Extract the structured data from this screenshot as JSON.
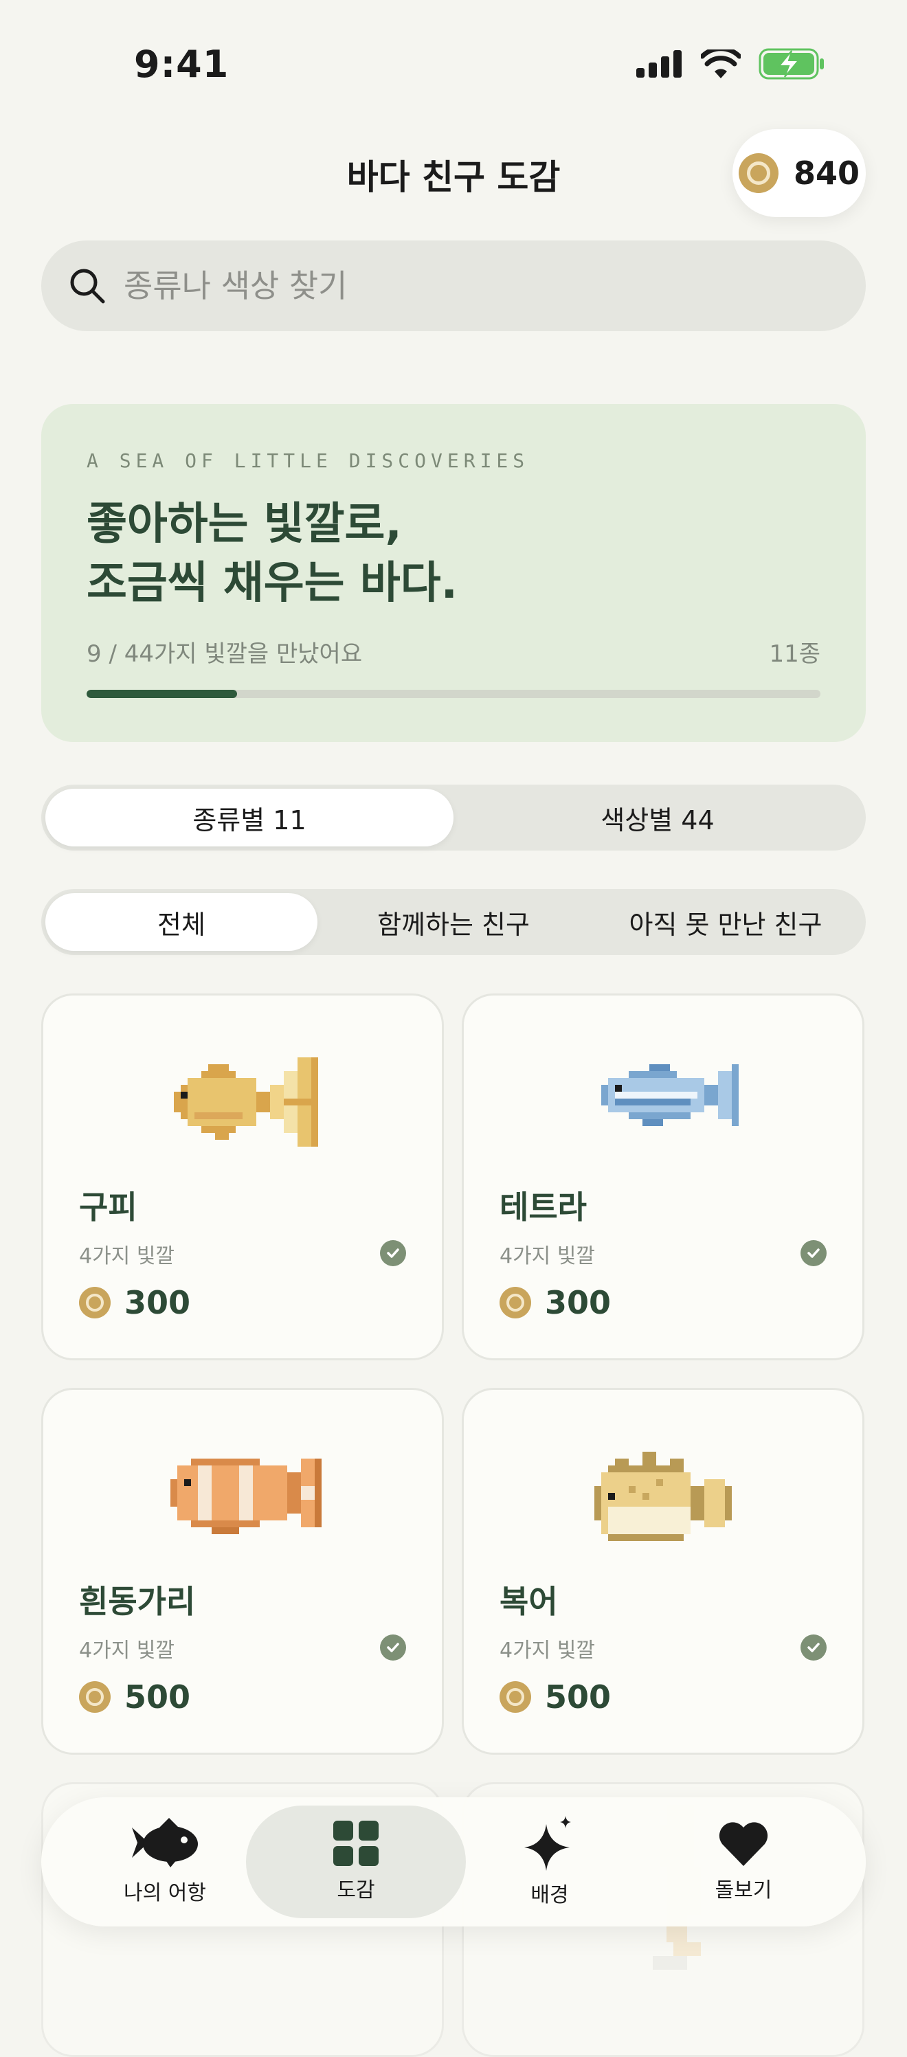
{
  "status_bar": {
    "time": "9:41"
  },
  "header": {
    "title": "바다 친구 도감",
    "coins": "840"
  },
  "search": {
    "placeholder": "종류나 색상 찾기"
  },
  "hero": {
    "eyebrow": "A SEA OF LITTLE DISCOVERIES",
    "title_line1": "좋아하는 빛깔로,",
    "title_line2": "조금씩 채우는 바다.",
    "progress_text": "9 / 44가지 빛깔을 만났어요",
    "species_count": "11종",
    "progress_value": 0.205
  },
  "view_tabs": [
    {
      "label": "종류별 11",
      "active": true
    },
    {
      "label": "색상별 44",
      "active": false
    }
  ],
  "filters": [
    {
      "label": "전체",
      "active": true
    },
    {
      "label": "함께하는 친구",
      "active": false
    },
    {
      "label": "아직 못 만난 친구",
      "active": false
    }
  ],
  "cards": [
    {
      "name": "구피",
      "colors": "4가지 빛깔",
      "price": "300",
      "owned": true,
      "icon": "guppy-icon"
    },
    {
      "name": "테트라",
      "colors": "4가지 빛깔",
      "price": "300",
      "owned": true,
      "icon": "tetra-icon"
    },
    {
      "name": "흰동가리",
      "colors": "4가지 빛깔",
      "price": "500",
      "owned": true,
      "icon": "clownfish-icon"
    },
    {
      "name": "복어",
      "colors": "4가지 빛깔",
      "price": "500",
      "owned": true,
      "icon": "pufferfish-icon"
    }
  ],
  "tab_bar": [
    {
      "label": "나의 어항",
      "icon": "fish-icon",
      "active": false
    },
    {
      "label": "도감",
      "icon": "grid-icon",
      "active": true
    },
    {
      "label": "배경",
      "icon": "sparkle-icon",
      "active": false
    },
    {
      "label": "돌보기",
      "icon": "heart-icon",
      "active": false
    }
  ],
  "colors": {
    "background": "#f5f5f0",
    "accent_green": "#2d4a36",
    "coin_gold": "#c9a55c",
    "hero_bg": "#e3eddc"
  }
}
